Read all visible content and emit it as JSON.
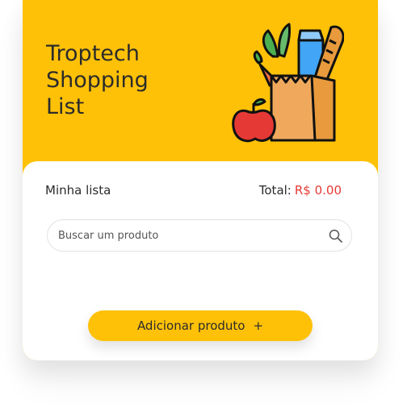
{
  "header": {
    "title": "Troptech\nShopping\nList"
  },
  "list": {
    "label": "Minha lista",
    "total_label": "Total:",
    "total_value": "R$ 0.00"
  },
  "search": {
    "placeholder": "Buscar um produto",
    "value": ""
  },
  "actions": {
    "add_label": "Adicionar produto",
    "add_icon": "+"
  },
  "colors": {
    "brand_yellow": "#ffc107",
    "total_red": "#e53935",
    "text_dark": "#2b2b2b"
  },
  "icons": {
    "header_illustration": "grocery-bag-icon",
    "search": "search-icon",
    "add": "plus-icon"
  }
}
